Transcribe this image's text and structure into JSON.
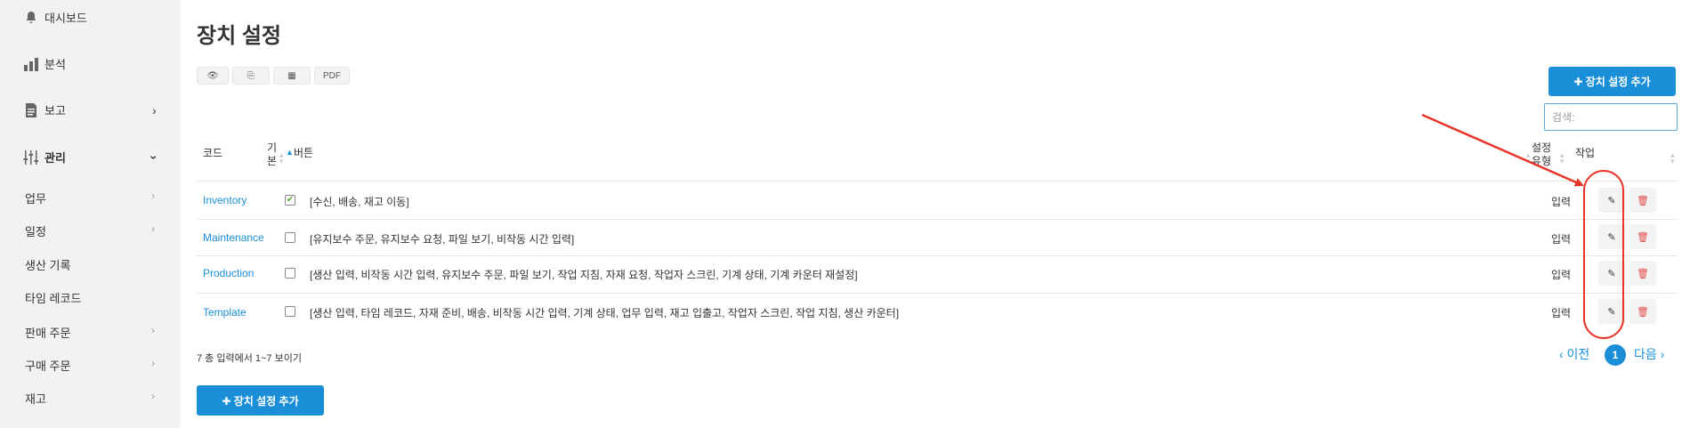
{
  "sidebar": {
    "top_items": [
      {
        "label": "대시보드",
        "icon": "bell-icon"
      },
      {
        "label": "분석",
        "icon": "bar-chart-icon"
      },
      {
        "label": "보고",
        "icon": "document-icon"
      },
      {
        "label": "관리",
        "icon": "sliders-icon"
      }
    ],
    "sub_items": [
      {
        "label": "업무"
      },
      {
        "label": "일정"
      },
      {
        "label": "생산 기록"
      },
      {
        "label": "타임 레코드"
      },
      {
        "label": "판매 주문"
      },
      {
        "label": "구매 주문"
      },
      {
        "label": "재고"
      }
    ]
  },
  "page": {
    "title": "장치 설정",
    "add_label": "✚ 장치 설정 추가",
    "search_placeholder": "검색:"
  },
  "toolbar": {
    "eye": "👁",
    "copy": "⎘",
    "grid": "▦",
    "pdf": "PDF"
  },
  "table": {
    "headers": {
      "code": "코드",
      "default_1": "기",
      "default_2": "본",
      "buttons": "버튼",
      "type_1": "설정",
      "type_2": "유형",
      "actions": "작업"
    },
    "rows": [
      {
        "code": "Inventory",
        "default": true,
        "buttons": "[수신, 배송, 재고 이동]",
        "type": "입력"
      },
      {
        "code": "Maintenance",
        "default": false,
        "buttons": "[유지보수 주문, 유지보수 요청, 파일 보기, 비작동 시간 입력]",
        "type": "입력"
      },
      {
        "code": "Production",
        "default": false,
        "buttons": "[생산 입력, 비작동 시간 입력, 유지보수 주문, 파일 보기, 작업 지침, 자재 요청, 작업자 스크린, 기계 상태, 기계 카운터 재설정]",
        "type": "입력"
      },
      {
        "code": "Template",
        "default": false,
        "buttons": "[생산 입력, 타임 레코드, 자재 준비, 배송, 비작동 시간 입력, 기계 상태, 업무 입력, 재고 입출고, 작업자 스크린, 작업 지침, 생산 카운터]",
        "type": "입력"
      }
    ],
    "check_mark": "✔",
    "edit_icon": "✎",
    "delete_icon": "🗑"
  },
  "footer": {
    "info": "7 총 입력에서 1~7 보이기",
    "prev": "‹ 이전",
    "page": "1",
    "next": "다음 ›"
  },
  "colors": {
    "accent": "#1a8fd8",
    "annotation": "#e8342a",
    "sidebar_bg": "#f2f2f2"
  }
}
